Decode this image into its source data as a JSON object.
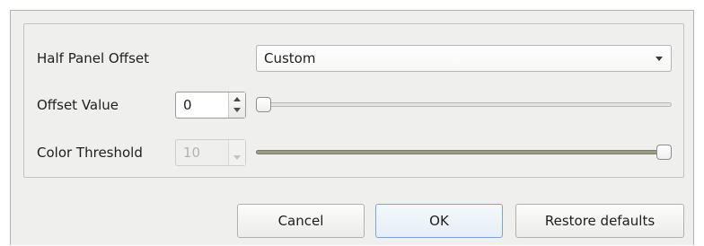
{
  "settings": {
    "half_panel_offset": {
      "label": "Half Panel Offset",
      "selected": "Custom"
    },
    "offset_value": {
      "label": "Offset Value",
      "value": "0",
      "slider_fraction": 0.0
    },
    "color_threshold": {
      "label": "Color Threshold",
      "value": "10",
      "slider_fraction": 1.0,
      "enabled": false
    }
  },
  "buttons": {
    "cancel": "Cancel",
    "ok": "OK",
    "restore_defaults": "Restore defaults"
  },
  "icons": {
    "combo_arrow": "chevron-down-icon",
    "spin_up": "spin-up-icon",
    "spin_down": "spin-down-icon"
  }
}
